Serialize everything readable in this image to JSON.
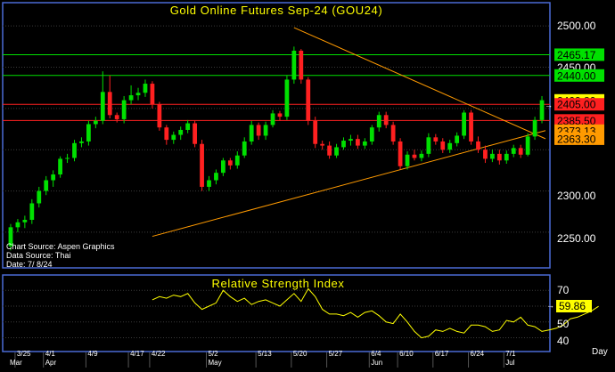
{
  "colors": {
    "background": "#000000",
    "frame": "#4a6bd6",
    "grid": "#3a3a3a",
    "title": "#ffff00",
    "bull": "#00e000",
    "bear": "#ff2020",
    "trendline": "#ff9a00",
    "rsi_line": "#ffff00",
    "axis_text": "#ffffff"
  },
  "price_panel": {
    "title": "Gold Online Futures Sep-24 (GOU24)",
    "source_lines": [
      "Chart Source: Aspen Graphics",
      "Data Source: Thai",
      "Date: 7/ 8/24"
    ],
    "y_ticks": [
      "2500.00",
      "2450.00",
      "2300.00",
      "2250.00"
    ],
    "level_labels": [
      {
        "text": "2465.17",
        "fill": "#00e000",
        "line": "#00e000"
      },
      {
        "text": "2440.00",
        "fill": "#00e000",
        "line": "#00e000"
      },
      {
        "text": "2409.80",
        "fill": "#ffff00",
        "line": null
      },
      {
        "text": "2405.00",
        "fill": "#ff2020",
        "line": "#ff2020"
      },
      {
        "text": "2385.50",
        "fill": "#ff2020",
        "line": "#ff2020"
      },
      {
        "text": "2373.13",
        "fill": "#ff9a00",
        "line": null
      },
      {
        "text": "2363.30",
        "fill": "#ff9a00",
        "line": null
      }
    ]
  },
  "rsi_panel": {
    "title": "Relative Strength Index",
    "y_ticks": [
      "70",
      "60",
      "50",
      "40"
    ],
    "last_value_label": "59.86"
  },
  "x_axis": {
    "unit_label": "Day",
    "day_labels": [
      "3/25",
      "4/1",
      "4/9",
      "4/17",
      "4/22",
      "5/2",
      "5/13",
      "5/20",
      "5/27",
      "6/4",
      "6/10",
      "6/17",
      "6/24",
      "7/1"
    ],
    "month_labels": [
      "Mar",
      "Apr",
      "May",
      "Jun",
      "Jul"
    ]
  },
  "chart_data": [
    {
      "type": "candlestick",
      "title": "Gold Online Futures Sep-24 (GOU24)",
      "ylim": [
        2210,
        2525
      ],
      "x": [
        "3/22",
        "3/25",
        "3/26",
        "3/27",
        "3/28",
        "4/1",
        "4/2",
        "4/3",
        "4/4",
        "4/5",
        "4/8",
        "4/9",
        "4/10",
        "4/11",
        "4/12",
        "4/15",
        "4/16",
        "4/17",
        "4/18",
        "4/19",
        "4/22",
        "4/23",
        "4/24",
        "4/25",
        "4/26",
        "4/29",
        "4/30",
        "5/1",
        "5/2",
        "5/3",
        "5/6",
        "5/7",
        "5/8",
        "5/9",
        "5/10",
        "5/13",
        "5/14",
        "5/15",
        "5/16",
        "5/17",
        "5/20",
        "5/21",
        "5/22",
        "5/23",
        "5/24",
        "5/27",
        "5/28",
        "5/29",
        "5/30",
        "5/31",
        "6/3",
        "6/4",
        "6/5",
        "6/6",
        "6/7",
        "6/10",
        "6/11",
        "6/12",
        "6/13",
        "6/14",
        "6/17",
        "6/18",
        "6/19",
        "6/20",
        "6/21",
        "6/24",
        "6/25",
        "6/26",
        "6/27",
        "6/28",
        "7/1",
        "7/2",
        "7/3",
        "7/4",
        "7/5",
        "7/8"
      ],
      "open": [
        2233,
        2256,
        2262,
        2265,
        2285,
        2300,
        2313,
        2320,
        2339,
        2340,
        2358,
        2360,
        2381,
        2385,
        2420,
        2392,
        2387,
        2410,
        2416,
        2419,
        2430,
        2405,
        2377,
        2362,
        2368,
        2374,
        2382,
        2357,
        2305,
        2313,
        2322,
        2337,
        2331,
        2343,
        2360,
        2380,
        2367,
        2380,
        2394,
        2390,
        2435,
        2470,
        2435,
        2385,
        2357,
        2355,
        2343,
        2353,
        2361,
        2363,
        2355,
        2360,
        2377,
        2392,
        2380,
        2360,
        2330,
        2344,
        2340,
        2345,
        2365,
        2360,
        2350,
        2358,
        2367,
        2395,
        2360,
        2350,
        2339,
        2345,
        2337,
        2345,
        2352,
        2344,
        2366,
        2386
      ],
      "close": [
        2256,
        2262,
        2265,
        2285,
        2300,
        2313,
        2320,
        2339,
        2340,
        2358,
        2360,
        2381,
        2385,
        2420,
        2392,
        2387,
        2410,
        2416,
        2419,
        2430,
        2405,
        2377,
        2362,
        2368,
        2374,
        2382,
        2357,
        2305,
        2313,
        2322,
        2337,
        2331,
        2343,
        2360,
        2380,
        2367,
        2380,
        2394,
        2390,
        2435,
        2470,
        2435,
        2385,
        2357,
        2355,
        2343,
        2353,
        2361,
        2363,
        2355,
        2360,
        2377,
        2392,
        2380,
        2360,
        2330,
        2344,
        2340,
        2345,
        2365,
        2360,
        2350,
        2358,
        2367,
        2395,
        2360,
        2350,
        2339,
        2345,
        2337,
        2345,
        2352,
        2344,
        2366,
        2386,
        2410
      ],
      "high": [
        2260,
        2266,
        2270,
        2290,
        2305,
        2318,
        2325,
        2342,
        2345,
        2362,
        2365,
        2385,
        2390,
        2445,
        2440,
        2395,
        2415,
        2428,
        2425,
        2435,
        2433,
        2408,
        2380,
        2372,
        2378,
        2386,
        2385,
        2362,
        2318,
        2326,
        2340,
        2340,
        2348,
        2365,
        2385,
        2383,
        2384,
        2398,
        2397,
        2440,
        2475,
        2472,
        2438,
        2390,
        2361,
        2360,
        2357,
        2365,
        2368,
        2368,
        2364,
        2380,
        2396,
        2396,
        2384,
        2364,
        2348,
        2350,
        2349,
        2370,
        2369,
        2364,
        2362,
        2371,
        2398,
        2398,
        2366,
        2355,
        2350,
        2350,
        2349,
        2356,
        2356,
        2370,
        2390,
        2415
      ],
      "low": [
        2228,
        2250,
        2255,
        2260,
        2280,
        2295,
        2305,
        2316,
        2334,
        2336,
        2353,
        2355,
        2376,
        2381,
        2388,
        2383,
        2382,
        2405,
        2410,
        2414,
        2400,
        2373,
        2356,
        2357,
        2362,
        2370,
        2353,
        2300,
        2300,
        2308,
        2318,
        2326,
        2327,
        2340,
        2356,
        2362,
        2362,
        2377,
        2385,
        2386,
        2430,
        2430,
        2380,
        2352,
        2350,
        2339,
        2340,
        2350,
        2355,
        2351,
        2351,
        2356,
        2372,
        2376,
        2356,
        2326,
        2326,
        2337,
        2336,
        2341,
        2356,
        2346,
        2346,
        2354,
        2363,
        2356,
        2346,
        2334,
        2335,
        2332,
        2333,
        2341,
        2340,
        2342,
        2362,
        2382
      ],
      "horizontal_levels": [
        2465.17,
        2440.0,
        2405.0,
        2385.5
      ],
      "trendlines": [
        {
          "from": [
            "4/22",
            2245
          ],
          "to": [
            "7/8",
            2373.13
          ]
        },
        {
          "from": [
            "5/20",
            2498
          ],
          "to": [
            "7/8",
            2363.3
          ]
        }
      ],
      "last_price": 2409.8
    },
    {
      "type": "line",
      "title": "Relative Strength Index",
      "ylim": [
        33,
        78
      ],
      "x_start": "4/22",
      "values": [
        64,
        66,
        65,
        67,
        66,
        68,
        62,
        58,
        60,
        62,
        70,
        66,
        63,
        65,
        61,
        63,
        64,
        62,
        60,
        64,
        68,
        63,
        71,
        66,
        58,
        55,
        55,
        54,
        56,
        53,
        56,
        57,
        54,
        50,
        49,
        55,
        50,
        44,
        40,
        41,
        45,
        44,
        46,
        44,
        43,
        48,
        48,
        47,
        44,
        45,
        51,
        50,
        53,
        48,
        47,
        44,
        45,
        46,
        48,
        52,
        53,
        55,
        57,
        59.86
      ]
    }
  ]
}
